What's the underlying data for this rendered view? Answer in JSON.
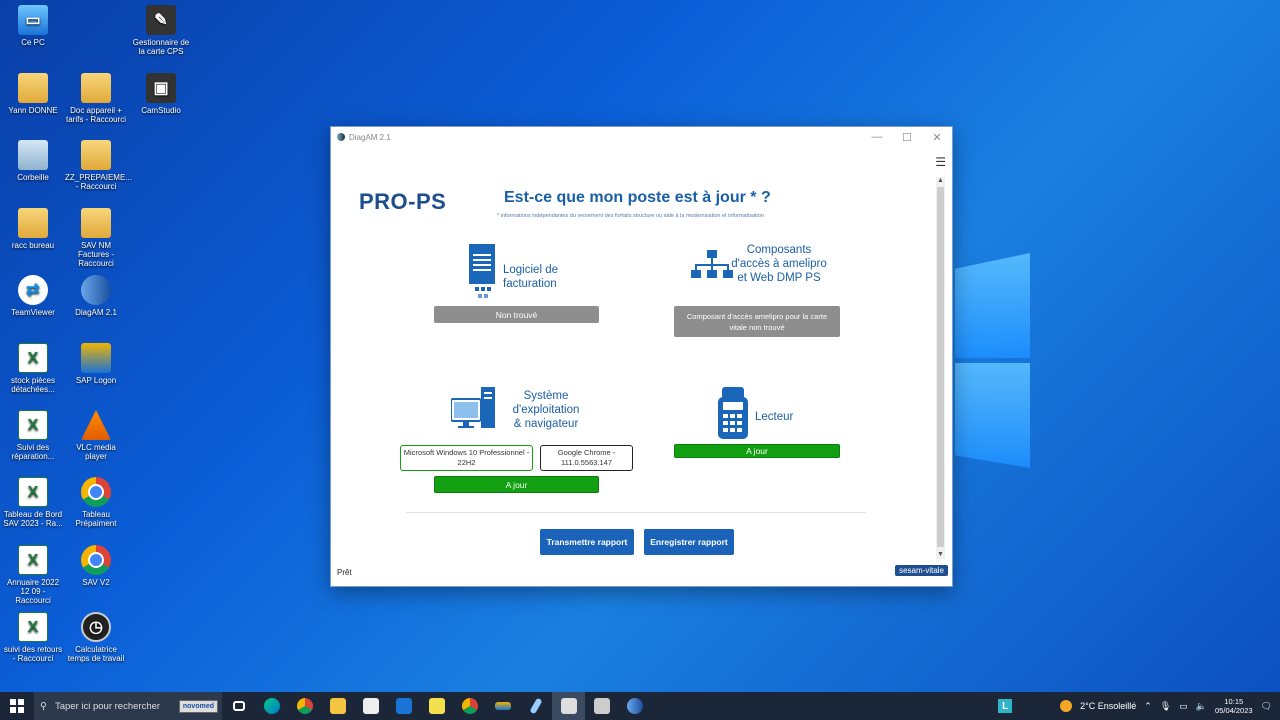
{
  "desktop": {
    "icons": [
      {
        "label": "Ce PC",
        "icon": "pc-icon"
      },
      {
        "label": "Gestionnaire de la carte CPS",
        "icon": "cps-manager-icon"
      },
      {
        "label": "Yann DONNE",
        "icon": "user-folder-icon"
      },
      {
        "label": "Doc appareil + tarifs - Raccourci",
        "icon": "folder-icon"
      },
      {
        "label": "CamStudio",
        "icon": "camstudio-icon"
      },
      {
        "label": "Corbeille",
        "icon": "recycle-bin-icon"
      },
      {
        "label": "ZZ_PREPAIEME... - Raccourci",
        "icon": "folder-icon"
      },
      {
        "label": "racc bureau",
        "icon": "folder-icon"
      },
      {
        "label": "SAV NM Factures - Raccourci",
        "icon": "folder-icon"
      },
      {
        "label": "TeamViewer",
        "icon": "teamviewer-icon"
      },
      {
        "label": "DiagAM 2.1",
        "icon": "diagam-icon"
      },
      {
        "label": "stock pièces détachées...",
        "icon": "excel-icon"
      },
      {
        "label": "SAP Logon",
        "icon": "sap-icon"
      },
      {
        "label": "Suivi des réparation...",
        "icon": "excel-icon"
      },
      {
        "label": "VLC media player",
        "icon": "vlc-icon"
      },
      {
        "label": "Tableau de Bord SAV 2023 - Ra...",
        "icon": "excel-icon"
      },
      {
        "label": "Tableau Prépaiment",
        "icon": "chrome-icon"
      },
      {
        "label": "Annuaire 2022 12 09 - Raccourci",
        "icon": "excel-icon"
      },
      {
        "label": "SAV V2",
        "icon": "chrome-icon"
      },
      {
        "label": "suivi des retours - Raccourci",
        "icon": "excel-icon"
      },
      {
        "label": "Calculatrice temps de travail",
        "icon": "clock-icon"
      }
    ]
  },
  "window": {
    "title": "DiagAM 2.1",
    "logo": "PRO-PS",
    "headline": "Est-ce que mon poste est à jour * ?",
    "headnote": "* informations indépendantes du versement des forfaits structure ou aide à la modernisation et informatisation",
    "sections": {
      "billing": {
        "label_line1": "Logiciel de",
        "label_line2": "facturation",
        "status": "Non trouvé"
      },
      "components": {
        "label_line1": "Composants",
        "label_line2": "d'accès à amelipro",
        "label_line3": "et Web DMP PS",
        "status": "Composant d'accès amelipro pour la carte vitale non trouvé"
      },
      "system": {
        "label_line1": "Système",
        "label_line2": "d'exploitation",
        "label_line3": "& navigateur",
        "os": "Microsoft Windows 10 Professionnel - 22H2",
        "browser": "Google Chrome - 111.0.5563.147",
        "status": "A jour"
      },
      "reader": {
        "label": "Lecteur",
        "status": "A jour"
      }
    },
    "actions": {
      "transmit": "Transmettre rapport",
      "save": "Enregistrer rapport"
    },
    "status_text": "Prêt",
    "brand": "sesam-vitale",
    "colors": {
      "green": "#12a012",
      "grey": "#8e8e8e",
      "blue": "#1b63b8"
    }
  },
  "taskbar": {
    "search_placeholder": "Taper ici pour rechercher",
    "novomed": "novomed",
    "weather": "2°C  Ensoleillé",
    "time": "10:15",
    "date": "05/04/2023",
    "l_badge": "L"
  }
}
